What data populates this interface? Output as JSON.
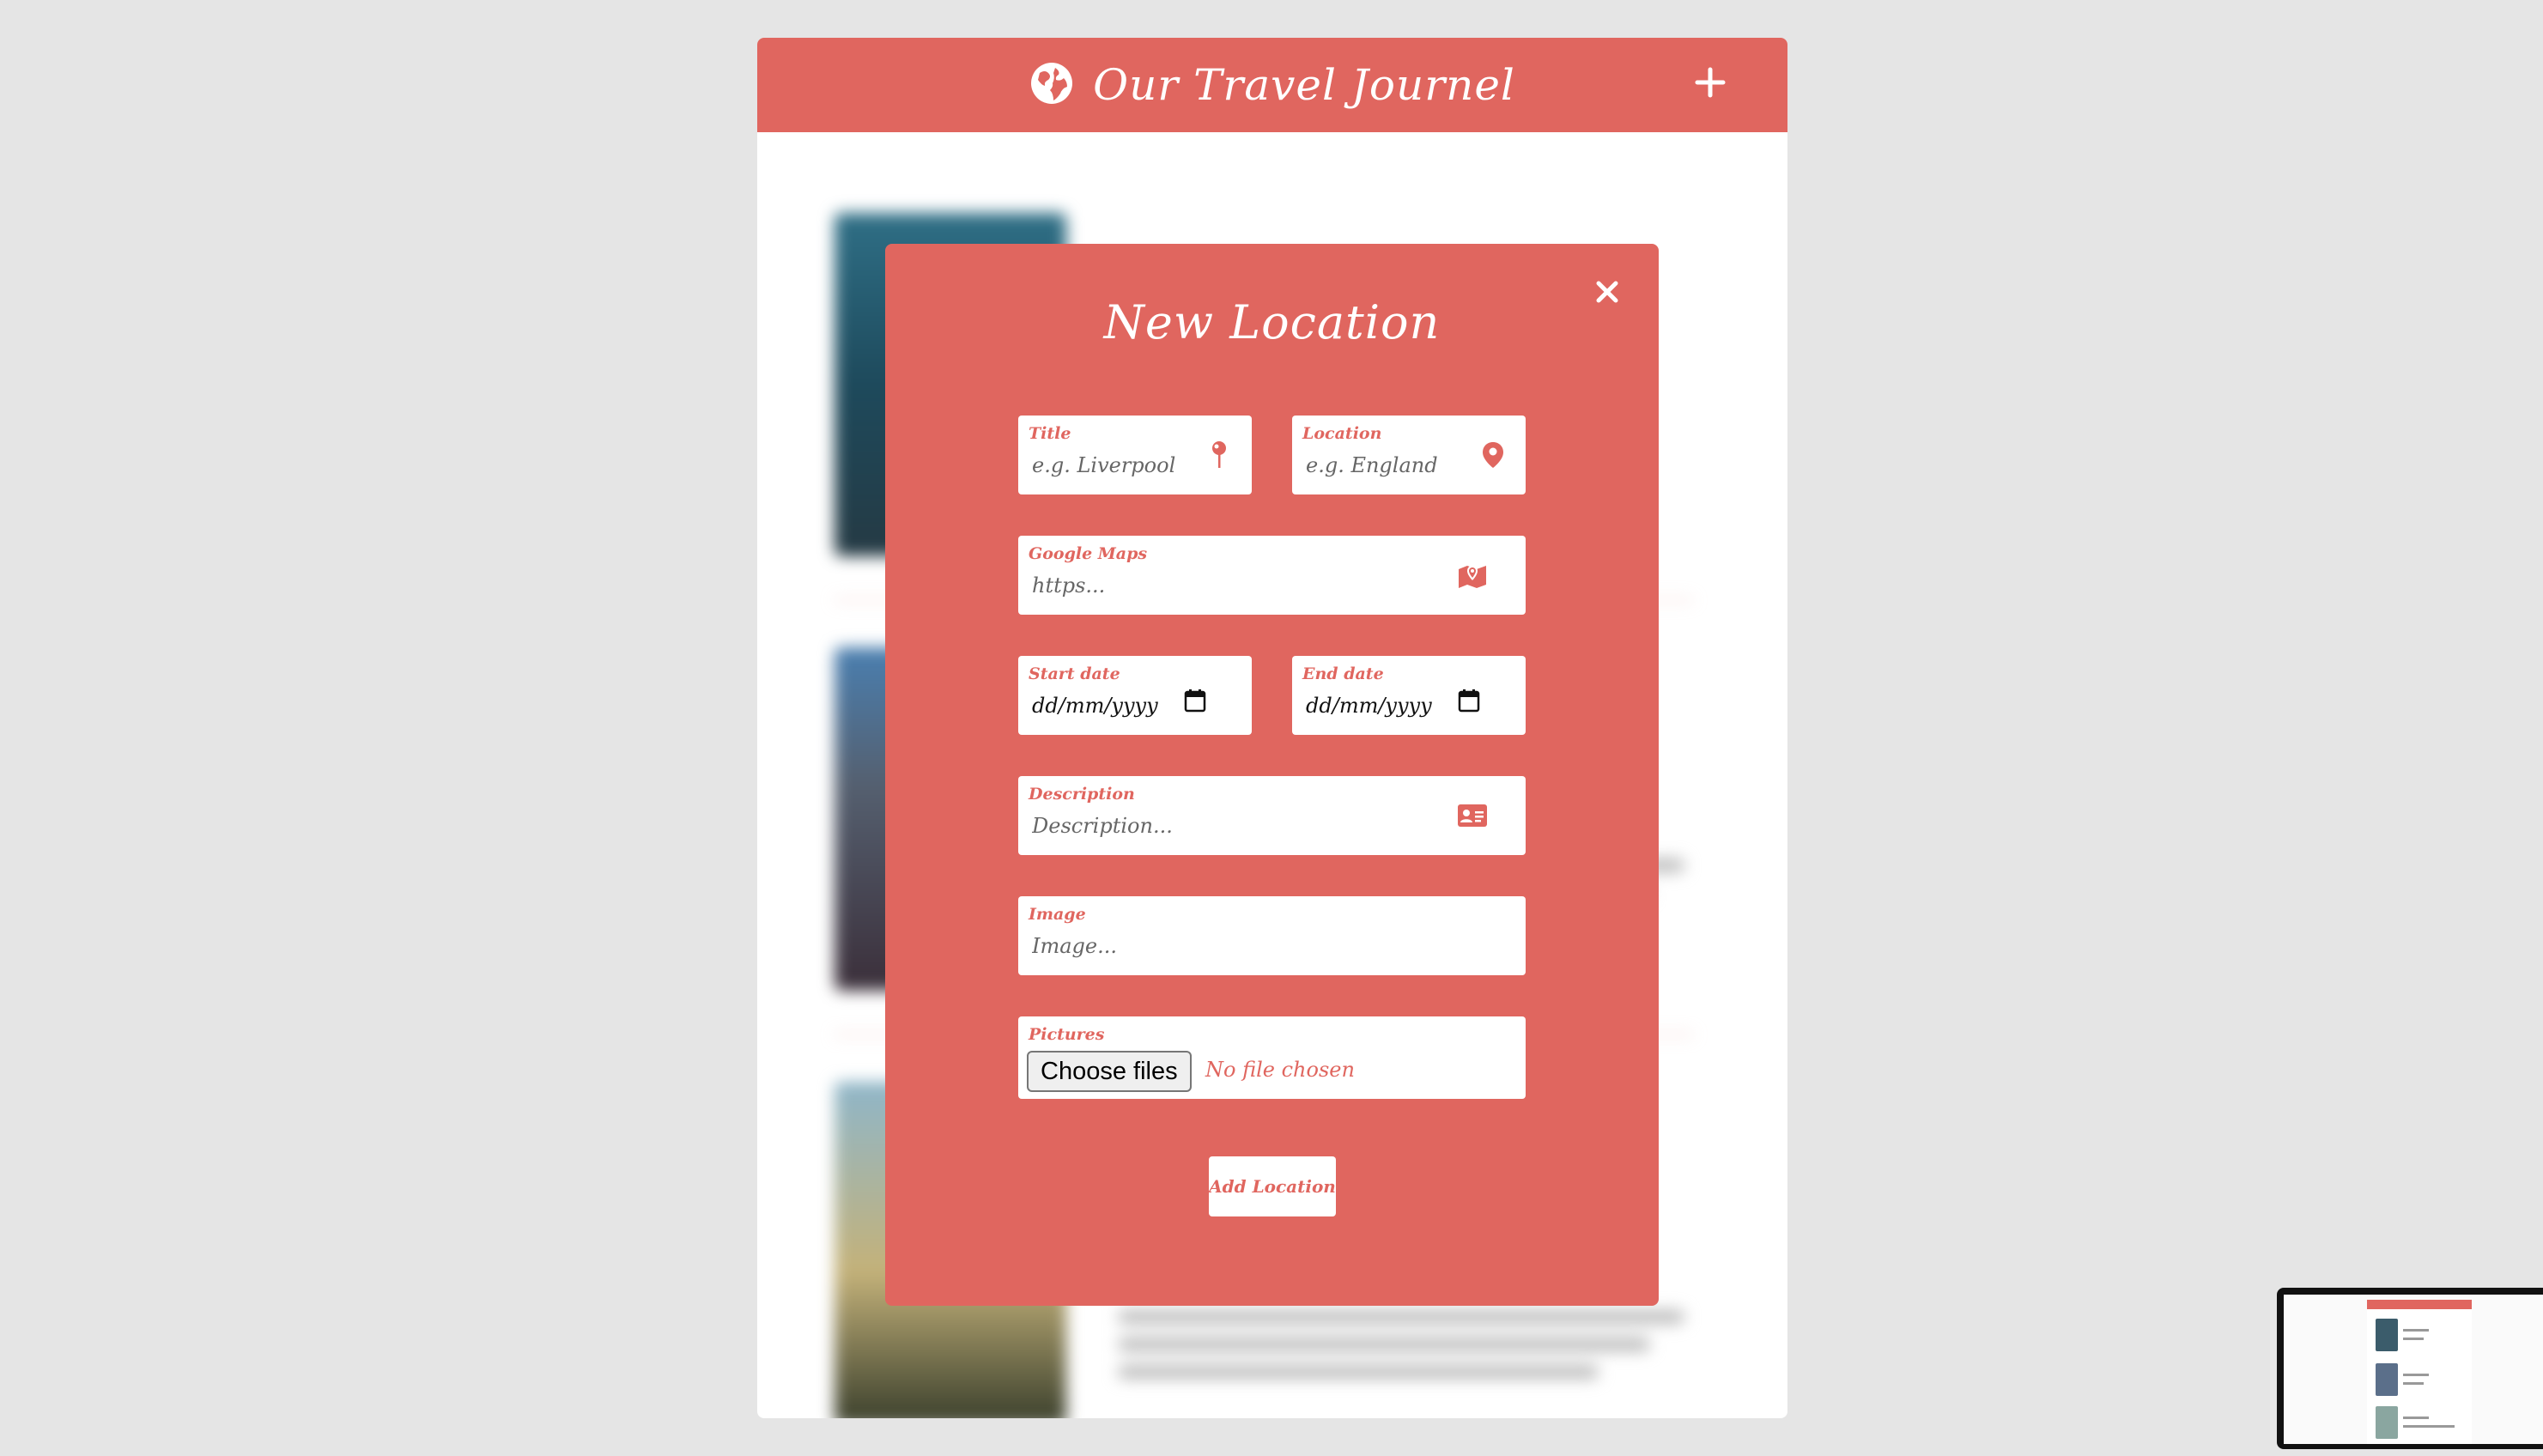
{
  "app": {
    "title": "Our Travel Journel",
    "icons": {
      "brand": "globe-icon",
      "add": "plus-icon"
    },
    "colors": {
      "accent": "#e0665f",
      "background": "#e5e5e5",
      "card": "#ffffff"
    }
  },
  "modal": {
    "title": "New Location",
    "close_icon": "close-icon",
    "fields": {
      "title": {
        "label": "Title",
        "placeholder": "e.g. Liverpool",
        "icon": "pin-icon"
      },
      "location": {
        "label": "Location",
        "placeholder": "e.g. England",
        "icon": "map-marker-icon"
      },
      "maps": {
        "label": "Google Maps",
        "placeholder": "https...",
        "icon": "map-icon"
      },
      "start": {
        "label": "Start date",
        "value": "dd/mm/yyyy",
        "icon": "calendar-icon"
      },
      "end": {
        "label": "End date",
        "value": "dd/mm/yyyy",
        "icon": "calendar-icon"
      },
      "description": {
        "label": "Description",
        "placeholder": "Description...",
        "icon": "id-card-icon"
      },
      "image": {
        "label": "Image",
        "placeholder": "Image..."
      },
      "pictures": {
        "label": "Pictures",
        "button": "Choose files",
        "status": "No file chosen"
      }
    },
    "submit_label": "Add Location"
  }
}
